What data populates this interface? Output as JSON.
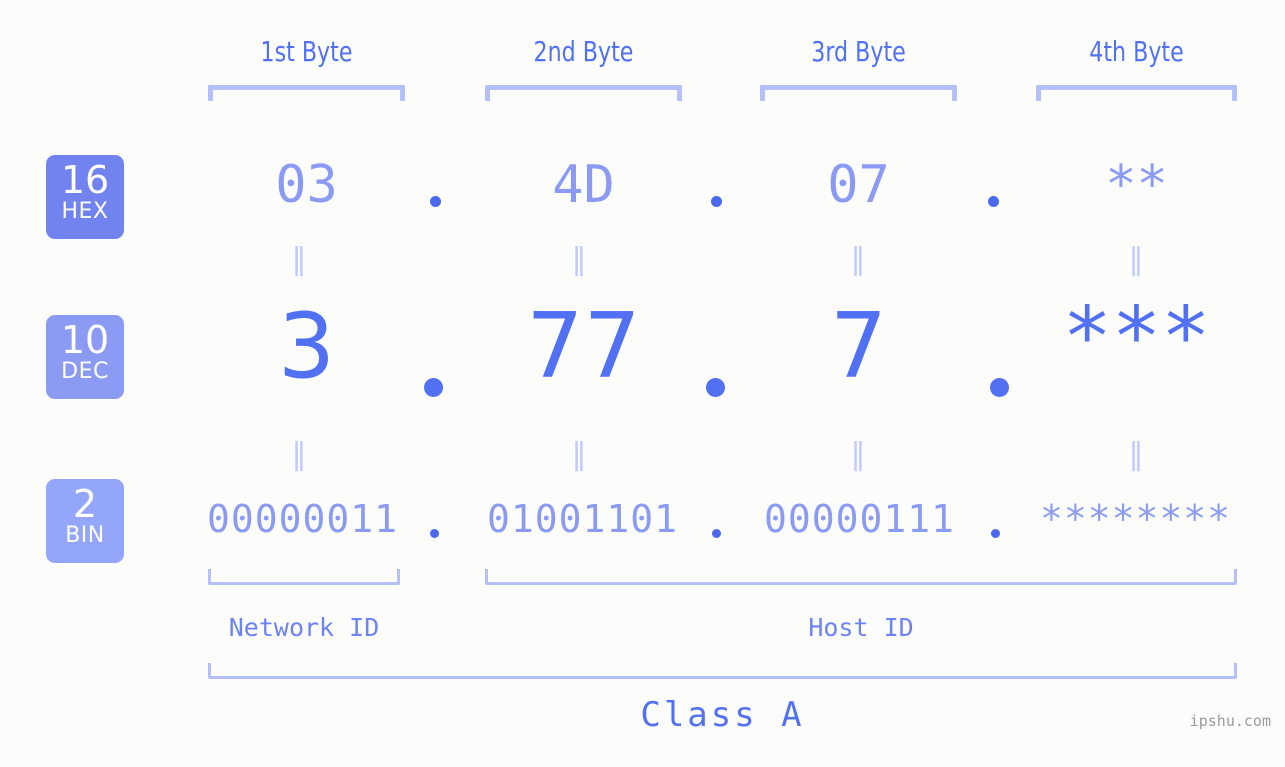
{
  "background_color": "#fcfdfa",
  "accent_color": "#5271f2",
  "accent_light_color": "#8b9bf4",
  "bracket_color": "#b5c0fb",
  "byte_headers": [
    {
      "label": "1st Byte"
    },
    {
      "label": "2nd Byte"
    },
    {
      "label": "3rd Byte"
    },
    {
      "label": "4th Byte"
    }
  ],
  "bases": [
    {
      "number": "16",
      "system": "HEX",
      "color": "#7183ee"
    },
    {
      "number": "10",
      "system": "DEC",
      "color": "#8b9bf4"
    },
    {
      "number": "2",
      "system": "BIN",
      "color": "#93a6fa"
    }
  ],
  "rows": {
    "hex": {
      "values": [
        "03",
        "4D",
        "07",
        "**"
      ]
    },
    "dec": {
      "values": [
        "3",
        "77",
        "7",
        "***"
      ]
    },
    "bin": {
      "values": [
        "00000011",
        "01001101",
        "00000111",
        "********"
      ]
    }
  },
  "equality_symbol": "‖",
  "separator_symbol": ".",
  "segments": {
    "network_id": "Network ID",
    "host_id": "Host ID"
  },
  "class_label": "Class A",
  "watermark": "ipshu.com"
}
